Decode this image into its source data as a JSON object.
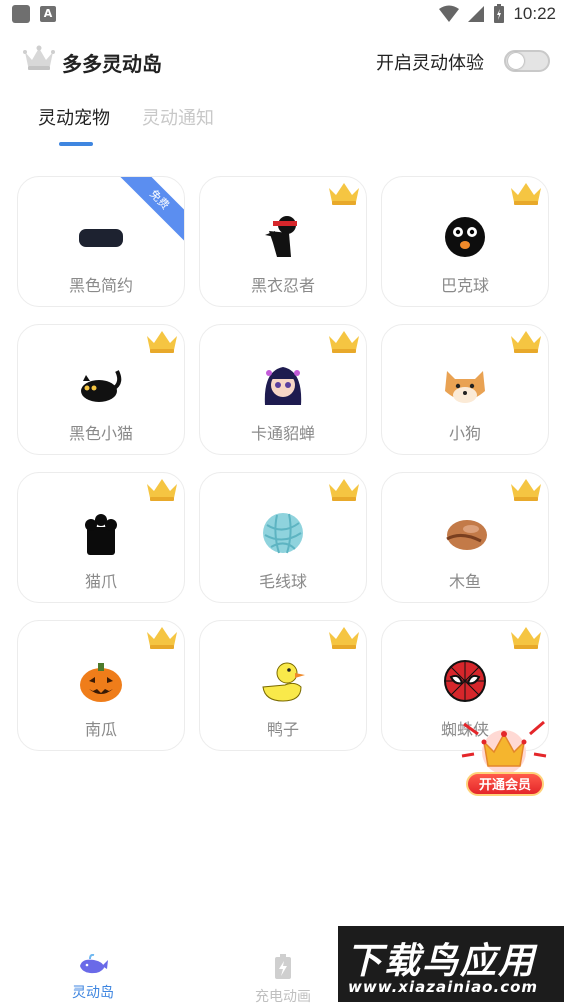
{
  "status_bar": {
    "time": "10:22"
  },
  "header": {
    "title": "多多灵动岛",
    "toggle_label": "开启灵动体验",
    "toggle_on": false
  },
  "tabs": [
    {
      "label": "灵动宠物",
      "active": true
    },
    {
      "label": "灵动通知",
      "active": false
    }
  ],
  "pets": [
    {
      "label": "黑色简约",
      "icon": "black-pill-icon",
      "badge": "免费"
    },
    {
      "label": "黑衣忍者",
      "icon": "ninja-icon",
      "badge": "crown"
    },
    {
      "label": "巴克球",
      "icon": "black-ball-icon",
      "badge": "crown"
    },
    {
      "label": "黑色小猫",
      "icon": "black-cat-icon",
      "badge": "crown"
    },
    {
      "label": "卡通貂蝉",
      "icon": "cartoon-girl-icon",
      "badge": "crown"
    },
    {
      "label": "小狗",
      "icon": "shiba-dog-icon",
      "badge": "crown"
    },
    {
      "label": "猫爪",
      "icon": "cat-paw-icon",
      "badge": "crown"
    },
    {
      "label": "毛线球",
      "icon": "yarn-ball-icon",
      "badge": "crown"
    },
    {
      "label": "木鱼",
      "icon": "wooden-fish-icon",
      "badge": "crown"
    },
    {
      "label": "南瓜",
      "icon": "pumpkin-icon",
      "badge": "crown"
    },
    {
      "label": "鸭子",
      "icon": "duck-icon",
      "badge": "crown"
    },
    {
      "label": "蜘蛛侠",
      "icon": "spiderman-icon",
      "badge": "crown"
    }
  ],
  "vip": {
    "label": "开通会员"
  },
  "bottom_nav": [
    {
      "label": "灵动岛",
      "icon": "whale-icon",
      "active": true
    },
    {
      "label": "充电动画",
      "icon": "battery-charge-icon",
      "active": false
    }
  ],
  "watermark": {
    "title": "下载鸟应用",
    "url": "www.xiazainiao.com"
  },
  "colors": {
    "accent": "#3f86e0",
    "crown": "#f5c542",
    "free_ribbon": "#5b8ef0"
  }
}
